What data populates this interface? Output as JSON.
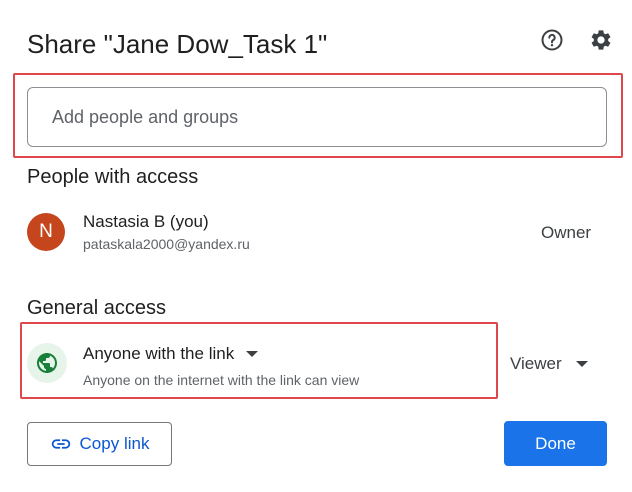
{
  "dialog": {
    "title": "Share \"Jane Dow_Task 1\""
  },
  "header_icons": {
    "help": "help-circle-icon",
    "settings": "gear-icon"
  },
  "add_people": {
    "placeholder": "Add people and groups",
    "value": ""
  },
  "people_section": {
    "label": "People with access",
    "people": [
      {
        "avatar_letter": "N",
        "avatar_color": "#c5461d",
        "name": "Nastasia B (you)",
        "email": "pataskala2000@yandex.ru",
        "role": "Owner"
      }
    ]
  },
  "general_access": {
    "label": "General access",
    "icon": "globe-icon",
    "selected": "Anyone with the link",
    "description": "Anyone on the internet with the link can view",
    "role": "Viewer"
  },
  "actions": {
    "copy_link_label": "Copy link",
    "copy_link_icon": "link-icon",
    "done_label": "Done"
  },
  "colors": {
    "accent": "#1a73e8",
    "link_text": "#0b57d0",
    "highlight": "#e0474c",
    "globe_bg": "#e6f4ea",
    "globe_fg": "#188038"
  }
}
